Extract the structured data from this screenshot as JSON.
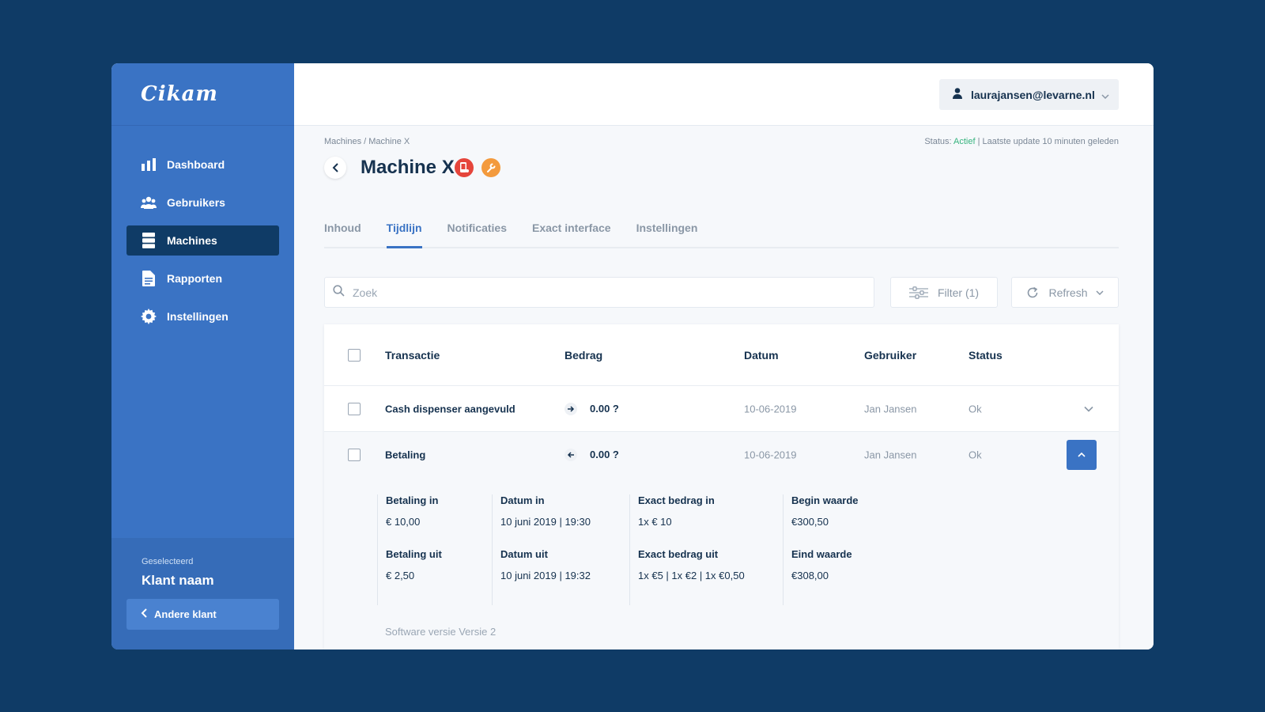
{
  "app": {
    "logo": "Cikam"
  },
  "sidebar": {
    "items": [
      {
        "label": "Dashboard",
        "icon": "bar-chart-icon"
      },
      {
        "label": "Gebruikers",
        "icon": "users-icon"
      },
      {
        "label": "Machines",
        "icon": "server-icon",
        "active": true
      },
      {
        "label": "Rapporten",
        "icon": "document-icon"
      },
      {
        "label": "Instellingen",
        "icon": "gear-icon"
      }
    ],
    "selected_label": "Geselecteerd",
    "selected_name": "Klant naam",
    "other_client": "Andere klant"
  },
  "header": {
    "user_email": "laurajansen@levarne.nl"
  },
  "page": {
    "breadcrumb": "Machines / Machine X",
    "status_prefix": "Status:",
    "status_value": "Actief",
    "status_suffix": "| Laatste update 10 minuten geleden",
    "title": "Machine X",
    "tabs": [
      "Inhoud",
      "Tijdlijn",
      "Notificaties",
      "Exact interface",
      "Instellingen"
    ],
    "active_tab": "Tijdlijn"
  },
  "toolbar": {
    "search_placeholder": "Zoek",
    "filter_label": "Filter (1)",
    "refresh_label": "Refresh"
  },
  "table": {
    "headers": {
      "transaction": "Transactie",
      "amount": "Bedrag",
      "date": "Datum",
      "user": "Gebruiker",
      "status": "Status"
    },
    "rows": [
      {
        "transaction": "Cash dispenser aangevuld",
        "direction": "in",
        "amount": "0.00 ?",
        "date": "10-06-2019",
        "user": "Jan Jansen",
        "status": "Ok"
      },
      {
        "transaction": "Betaling",
        "direction": "out",
        "amount": "0.00 ?",
        "date": "10-06-2019",
        "user": "Jan Jansen",
        "status": "Ok"
      }
    ],
    "details": {
      "payment_in_label": "Betaling in",
      "payment_in": "€ 10,00",
      "payment_out_label": "Betaling uit",
      "payment_out": "€ 2,50",
      "date_in_label": "Datum in",
      "date_in": "10 juni 2019 | 19:30",
      "date_out_label": "Datum uit",
      "date_out": "10 juni 2019 | 19:32",
      "exact_in_label": "Exact bedrag in",
      "exact_in": "1x € 10",
      "exact_out_label": "Exact bedrag uit",
      "exact_out": "1x €5 | 1x €2 | 1x €0,50",
      "begin_label": "Begin waarde",
      "begin": "€300,50",
      "end_label": "Eind waarde",
      "end": "€308,00",
      "software_label": "Software versie",
      "software_value": "Versie 2"
    }
  },
  "colors": {
    "sidebar": "#3a73c4",
    "active_nav": "#0f3b66",
    "accent": "#3a73c4",
    "status_active": "#36b37e"
  }
}
